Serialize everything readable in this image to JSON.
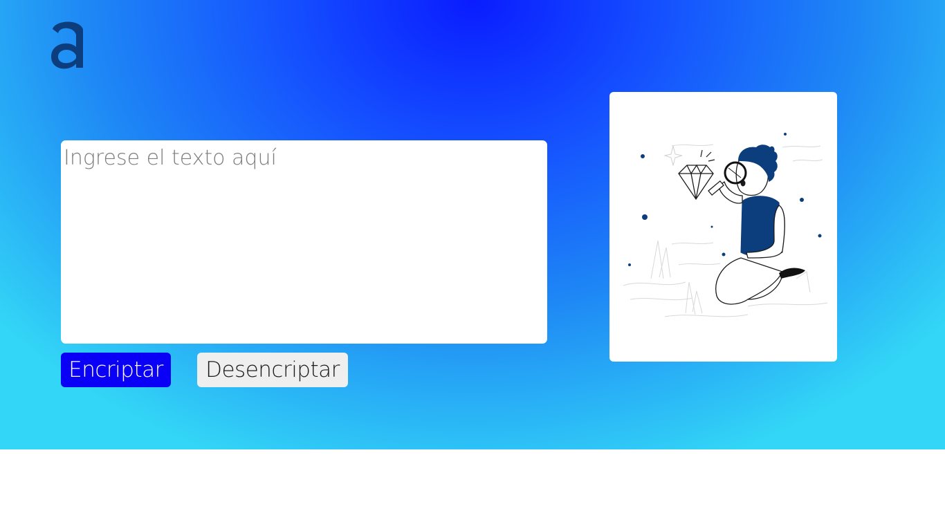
{
  "brand": {
    "logo_icon": "letter-a-logo",
    "logo_color": "#0c3e7d"
  },
  "colors": {
    "gradient_center": "#0a1cff",
    "gradient_edge": "#33d6f6",
    "encrypt_button": "#0a00f5",
    "decrypt_button": "#efefef"
  },
  "input": {
    "placeholder": "Ingrese el texto aquí",
    "value": ""
  },
  "buttons": {
    "encrypt_label": "Encriptar",
    "decrypt_label": "Desencriptar"
  },
  "illustration": {
    "icon": "person-with-magnifying-glass-and-diamond-illustration"
  }
}
